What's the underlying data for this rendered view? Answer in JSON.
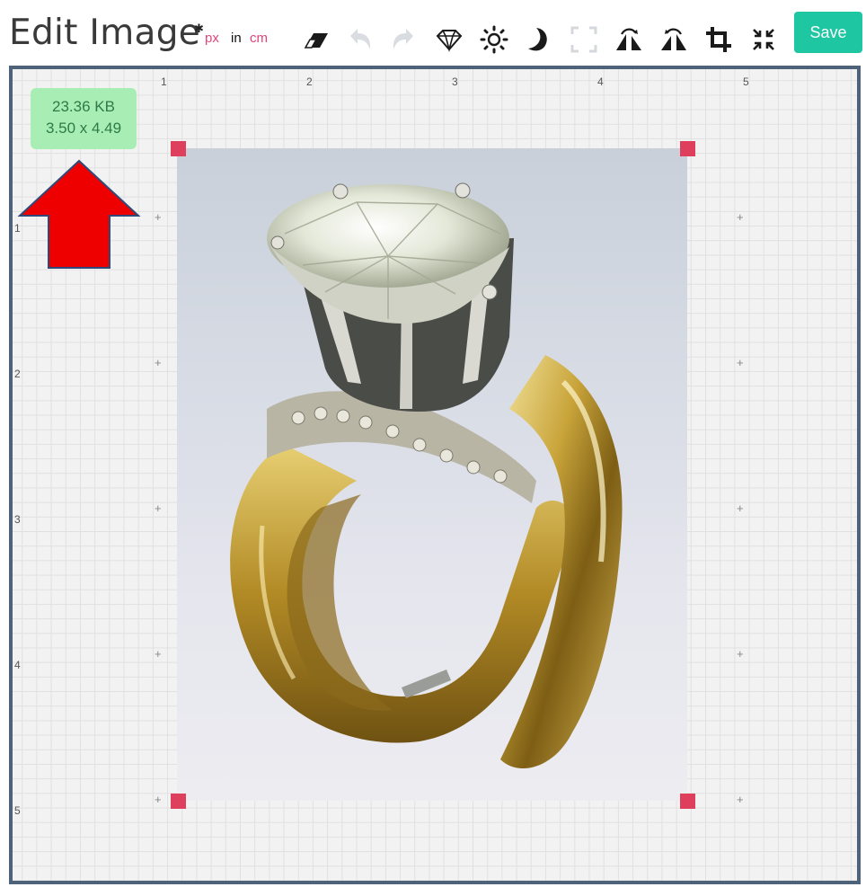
{
  "header": {
    "title": "Edit Image",
    "units": {
      "settings_icon": "gear-icon",
      "px": "px",
      "in": "in",
      "cm": "cm",
      "px_color": "#e0457b",
      "cm_color": "#e0457b"
    },
    "tools": [
      {
        "name": "eraser-icon"
      },
      {
        "name": "undo-icon"
      },
      {
        "name": "redo-icon"
      },
      {
        "name": "diamond-icon"
      },
      {
        "name": "brightness-icon"
      },
      {
        "name": "dark-mode-icon"
      },
      {
        "name": "selection-icon"
      },
      {
        "name": "flip-horizontal-icon"
      },
      {
        "name": "flip-vertical-icon"
      },
      {
        "name": "crop-icon"
      },
      {
        "name": "shrink-icon"
      }
    ],
    "save_label": "Save",
    "save_color": "#1ec6a2"
  },
  "canvas": {
    "ruler_top": [
      "1",
      "2",
      "3",
      "4",
      "5"
    ],
    "ruler_left": [
      "1",
      "2",
      "3",
      "4",
      "5"
    ],
    "info_badge": {
      "file_size": "23.36 KB",
      "dimensions": "3.50 x 4.49",
      "color": "#a8eeb4"
    },
    "handle_color": "#dd3f5c",
    "border_color": "#4e6279",
    "arrow_color": "#ee0000"
  }
}
